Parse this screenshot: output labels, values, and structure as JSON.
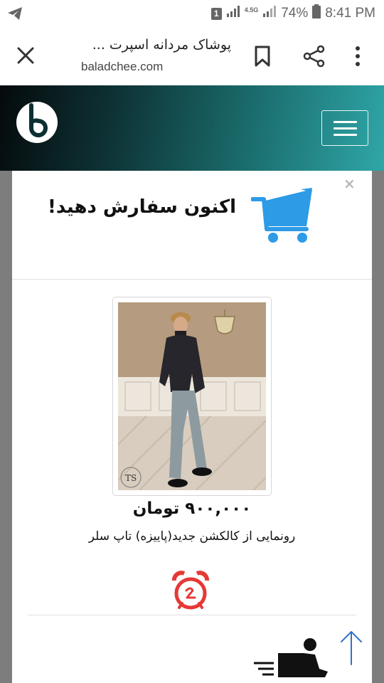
{
  "status_bar": {
    "notification_count": "1",
    "network_type": "4.5G",
    "battery": "74%",
    "time": "8:41 PM"
  },
  "browser": {
    "page_title": "پوشاک مردانه اسپرت ...",
    "url": "baladchee.com"
  },
  "site": {
    "logo_icon": "site-logo-icon",
    "menu_icon": "hamburger-icon",
    "brand_color": "#1b6d6d"
  },
  "modal": {
    "close_label": "×",
    "heading": "اکنون سفارش دهید!",
    "product": {
      "price": "۹۰۰,۰۰۰ تومان",
      "name": "رونمایی از کالکشن جدید(پاییزه) تاپ سلر",
      "photo_watermark": "TS"
    },
    "accent_color": "#2d9be6",
    "clock_color": "#e53935"
  }
}
